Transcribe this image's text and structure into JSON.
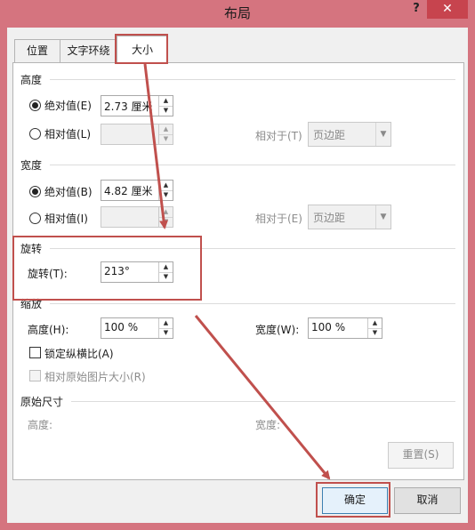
{
  "window": {
    "title": "布局",
    "help_label": "?",
    "close_label": "✕"
  },
  "tabs": [
    {
      "label": "位置"
    },
    {
      "label": "文字环绕"
    },
    {
      "label": "大小"
    }
  ],
  "height": {
    "section": "高度",
    "absolute_label": "绝对值(E)",
    "absolute_value": "2.73 厘米",
    "relative_label": "相对值(L)",
    "relative_value": "",
    "relative_to_label": "相对于(T)",
    "relative_to_value": "页边距"
  },
  "width": {
    "section": "宽度",
    "absolute_label": "绝对值(B)",
    "absolute_value": "4.82 厘米",
    "relative_label": "相对值(I)",
    "relative_value": "",
    "relative_to_label": "相对于(E)",
    "relative_to_value": "页边距"
  },
  "rotation": {
    "section": "旋转",
    "label": "旋转(T):",
    "value": "213°"
  },
  "scale": {
    "section": "缩放",
    "height_label": "高度(H):",
    "height_value": "100 %",
    "width_label": "宽度(W):",
    "width_value": "100 %",
    "lock_aspect_label": "锁定纵横比(A)",
    "relative_original_label": "相对原始图片大小(R)"
  },
  "original_size": {
    "section": "原始尺寸",
    "height_label": "高度:",
    "width_label": "宽度:",
    "reset_label": "重置(S)"
  },
  "footer": {
    "ok_label": "确定",
    "cancel_label": "取消"
  },
  "colors": {
    "window_frame": "#d5747f",
    "close_button": "#c7444e",
    "annotation": "#c0504d"
  }
}
